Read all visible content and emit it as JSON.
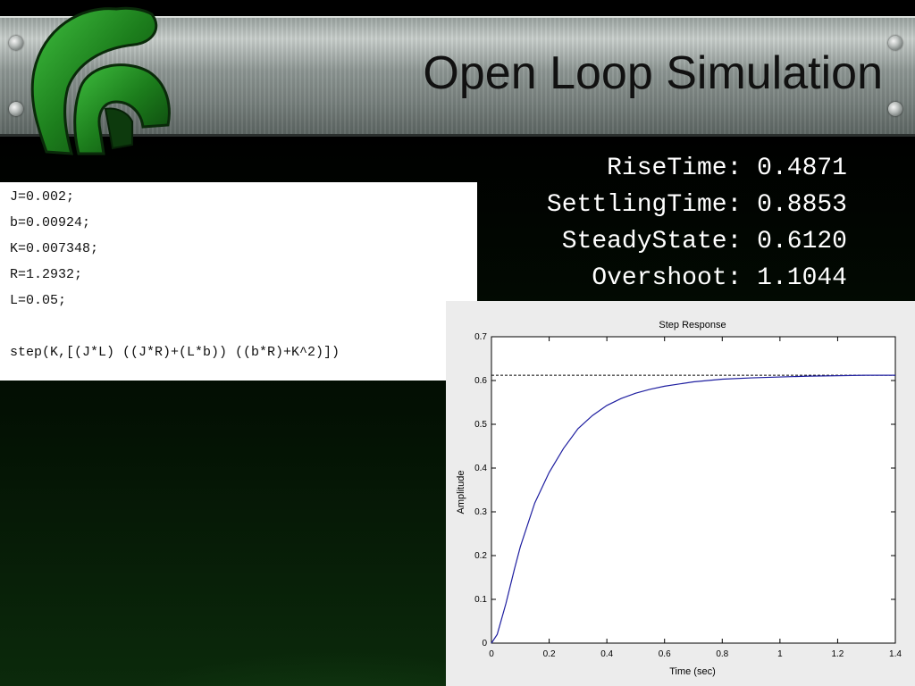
{
  "slide": {
    "title": "Open Loop Simulation"
  },
  "stats": [
    {
      "label": "RiseTime:",
      "value": "0.4871"
    },
    {
      "label": "SettlingTime:",
      "value": "0.8853"
    },
    {
      "label": "SteadyState:",
      "value": "0.6120"
    },
    {
      "label": "Overshoot:",
      "value": "1.1044"
    }
  ],
  "code": {
    "lines": [
      "J=0.002;",
      "b=0.00924;",
      "K=0.007348;",
      "R=1.2932;",
      "L=0.05;",
      "",
      "step(K,[(J*L) ((J*R)+(L*b)) ((b*R)+K^2)])"
    ]
  },
  "colors": {
    "series": "#1f1fa0",
    "reference": "#000000",
    "plot_bg": "#ffffff",
    "window_bg": "#ececec"
  },
  "chart_data": {
    "type": "line",
    "title": "Step Response",
    "xlabel": "Time (sec)",
    "ylabel": "Amplitude",
    "xlim": [
      0,
      1.4
    ],
    "ylim": [
      0,
      0.7
    ],
    "xticks": [
      0,
      0.2,
      0.4,
      0.6,
      0.8,
      1,
      1.2,
      1.4
    ],
    "yticks": [
      0,
      0.1,
      0.2,
      0.3,
      0.4,
      0.5,
      0.6,
      0.7
    ],
    "xtick_labels": [
      "0",
      "0.2",
      "0.4",
      "0.6",
      "0.8",
      "1",
      "1.2",
      "1.4"
    ],
    "ytick_labels": [
      "0",
      "0.1",
      "0.2",
      "0.3",
      "0.4",
      "0.5",
      "0.6",
      "0.7"
    ],
    "grid": false,
    "series": [
      {
        "x": [
          0,
          0.02,
          0.05,
          0.08,
          0.1,
          0.15,
          0.2,
          0.25,
          0.3,
          0.35,
          0.4,
          0.45,
          0.5,
          0.55,
          0.6,
          0.7,
          0.8,
          0.9,
          1.0,
          1.1,
          1.2,
          1.3,
          1.4
        ],
        "y": [
          0,
          0.02,
          0.09,
          0.17,
          0.22,
          0.32,
          0.39,
          0.445,
          0.49,
          0.52,
          0.543,
          0.559,
          0.571,
          0.58,
          0.587,
          0.597,
          0.603,
          0.606,
          0.608,
          0.61,
          0.611,
          0.612,
          0.612
        ]
      }
    ],
    "reference_lines": [
      {
        "axis": "y",
        "value": 0.612,
        "style": "dashed"
      }
    ]
  }
}
